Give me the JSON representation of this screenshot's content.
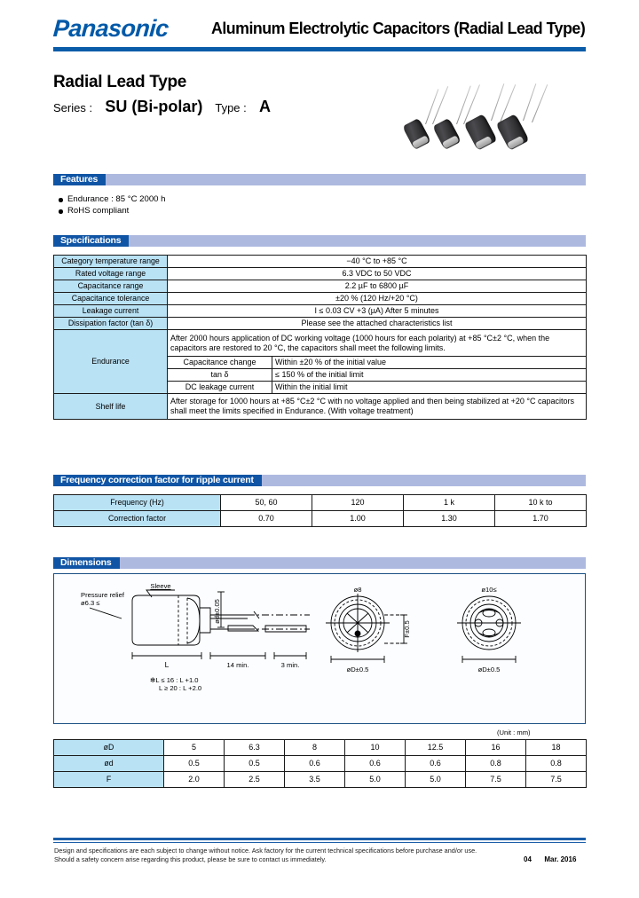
{
  "masthead": {
    "brand": "Panasonic",
    "title": "Aluminum Electrolytic Capacitors (Radial Lead Type)"
  },
  "title_block": {
    "heading": "Radial Lead Type",
    "series_label": "Series :",
    "series_value": "SU (Bi-polar)",
    "type_label": "Type :",
    "type_value": "A"
  },
  "features": {
    "header": "Features",
    "items": [
      "Endurance : 85 °C 2000 h",
      "RoHS compliant"
    ]
  },
  "specifications": {
    "header": "Specifications",
    "rows": [
      {
        "label": "Category temperature range",
        "value": "−40 °C to +85 °C"
      },
      {
        "label": "Rated voltage range",
        "value": "6.3 VDC to 50 VDC"
      },
      {
        "label": "Capacitance range",
        "value": "2.2 µF to 6800 µF"
      },
      {
        "label": "Capacitance tolerance",
        "value": "±20 % (120 Hz/+20 °C)"
      },
      {
        "label": "Leakage current",
        "value": "I ≤ 0.03 CV +3 (µA) After 5 minutes"
      },
      {
        "label": "Dissipation factor (tan δ)",
        "value": "Please see the attached characteristics list"
      }
    ],
    "endurance": {
      "label": "Endurance",
      "intro": "After 2000 hours application of DC working voltage (1000 hours for each polarity) at +85 °C±2 °C, when the capacitors are restored to 20 °C, the capacitors shall meet the following limits.",
      "sub_rows": [
        {
          "label": "Capacitance change",
          "value": "Within ±20 % of the initial value"
        },
        {
          "label": "tan δ",
          "value": "≤ 150 % of the initial limit"
        },
        {
          "label": "DC leakage current",
          "value": "Within the initial limit"
        }
      ]
    },
    "shelf_life": {
      "label": "Shelf life",
      "value": "After storage for 1000 hours at +85 °C±2 °C with no voltage applied and then being stabilized at +20 °C capacitors shall meet the limits specified in Endurance. (With voltage treatment)"
    }
  },
  "frequency": {
    "header": "Frequency correction factor for ripple current",
    "row_labels": [
      "Frequency (Hz)",
      "Correction factor"
    ],
    "frequencies": [
      "50, 60",
      "120",
      "1 k",
      "10 k to"
    ],
    "factors": [
      "0.70",
      "1.00",
      "1.30",
      "1.70"
    ]
  },
  "dimensions": {
    "header": "Dimensions",
    "unit_note": "(Unit : mm)",
    "drawing": {
      "pressure_relief": "Pressure relief",
      "pressure_relief_size": "ø6.3 ≤",
      "sleeve": "Sleeve",
      "lead_dia": "ød±0.05",
      "body_len": "L",
      "lead_len_1": "14 min.",
      "lead_len_2": "3 min.",
      "note_line1": "✻L ≤ 16 : L +1.0",
      "note_line2": "L ≥ 20 : L +2.0",
      "view_left_label": "ø8",
      "view_right_label": "ø10≤",
      "view_left_dia": "øD±0.5",
      "view_right_dia": "øD±0.5",
      "pitch_label": "F±0.5"
    },
    "table": {
      "row_labels": [
        "øD",
        "ød",
        "F"
      ],
      "D": [
        "5",
        "6.3",
        "8",
        "10",
        "12.5",
        "16",
        "18"
      ],
      "d": [
        "0.5",
        "0.5",
        "0.6",
        "0.6",
        "0.6",
        "0.8",
        "0.8"
      ],
      "F": [
        "2.0",
        "2.5",
        "3.5",
        "5.0",
        "5.0",
        "7.5",
        "7.5"
      ]
    }
  },
  "footer": {
    "line1": "Design and specifications are each subject to change without notice. Ask factory for the current technical specifications before purchase and/or use.",
    "line2": "Should a safety concern arise regarding this product, please be sure to contact us immediately.",
    "page": "04",
    "date": "Mar. 2016"
  },
  "colors": {
    "brand_blue": "#0059a8",
    "rule_blue": "#0a5ca8",
    "badge_blue": "#1055a5",
    "bar_lavender": "#aeb9e0",
    "label_cyan": "#b9e2f5"
  }
}
